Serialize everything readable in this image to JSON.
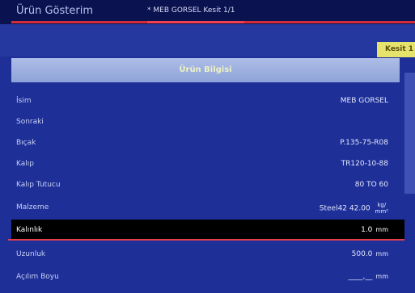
{
  "window": {
    "title": "Ürün Gösterim",
    "center_text": "* MEB GORSEL  Kesit 1/1"
  },
  "badge": {
    "label": "Kesit 1"
  },
  "panel": {
    "header": "Ürün Bilgisi"
  },
  "rows": [
    {
      "label": "İsim",
      "value": "MEB GORSEL",
      "unit": ""
    },
    {
      "label": "Sonraki",
      "value": "",
      "unit": ""
    },
    {
      "label": "Bıçak",
      "value": "P.135-75-R08",
      "unit": ""
    },
    {
      "label": "Kalıp",
      "value": "TR120-10-88",
      "unit": ""
    },
    {
      "label": "Kalıp Tutucu",
      "value": "80 TO 60",
      "unit": ""
    },
    {
      "label": "Malzeme",
      "value": "Steel42  42.00",
      "unit_num": "kg/",
      "unit_den": "mm²"
    },
    {
      "label": "Kalınlık",
      "value": "1.0",
      "unit": "mm"
    },
    {
      "label": "Uzunluk",
      "value": "500.0",
      "unit": "mm"
    },
    {
      "label": "Açılım Boyu",
      "value": "____,__",
      "unit": "mm"
    }
  ],
  "colors": {
    "background": "#1e2f98",
    "highlight_row": "#000000",
    "accent": "#e43e48",
    "badge": "#e5e36b"
  }
}
